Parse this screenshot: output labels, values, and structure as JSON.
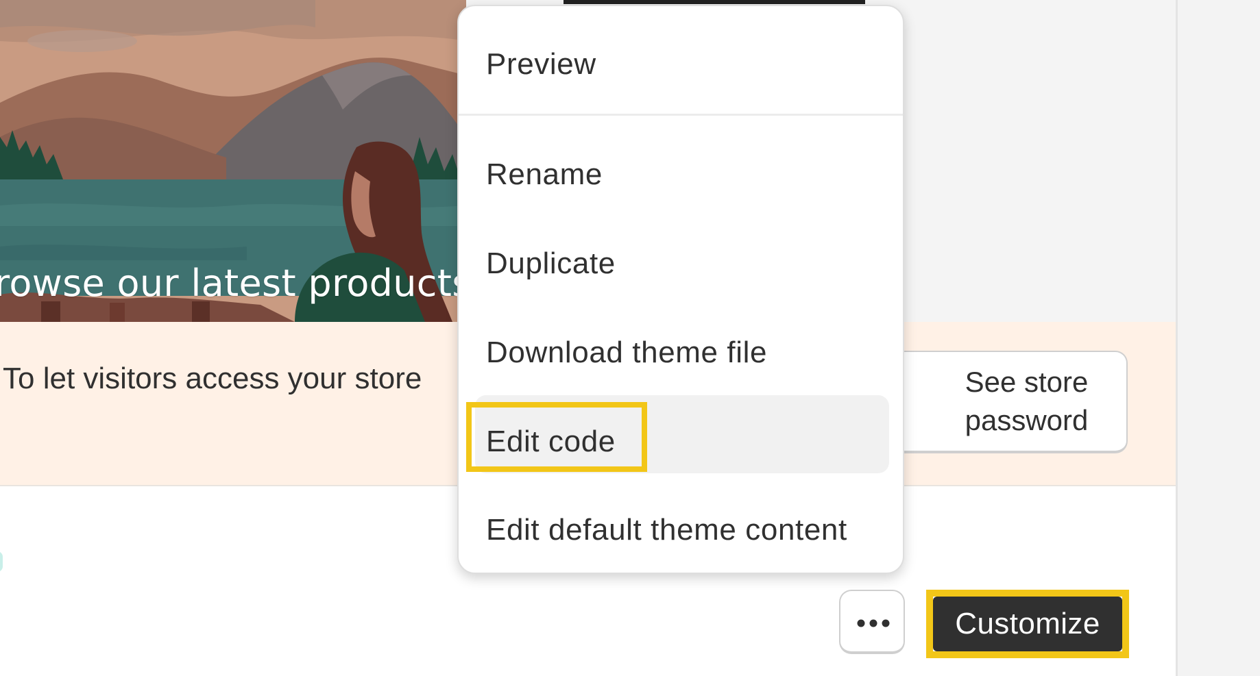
{
  "preview": {
    "caption": "rowse our latest products"
  },
  "banner": {
    "text": "To let visitors access your store",
    "button_label": "See store password"
  },
  "menu": {
    "items": [
      {
        "label": "Preview"
      },
      {
        "label": "Rename"
      },
      {
        "label": "Duplicate"
      },
      {
        "label": "Download theme file"
      },
      {
        "label": "Edit code",
        "state": "hovered"
      },
      {
        "label": "Edit default theme content"
      }
    ]
  },
  "actions": {
    "more_icon": "ellipsis-icon",
    "customize_label": "Customize"
  },
  "colors": {
    "highlight": "#f2c618",
    "banner_bg": "#fff1e6",
    "primary_button": "#303030"
  }
}
